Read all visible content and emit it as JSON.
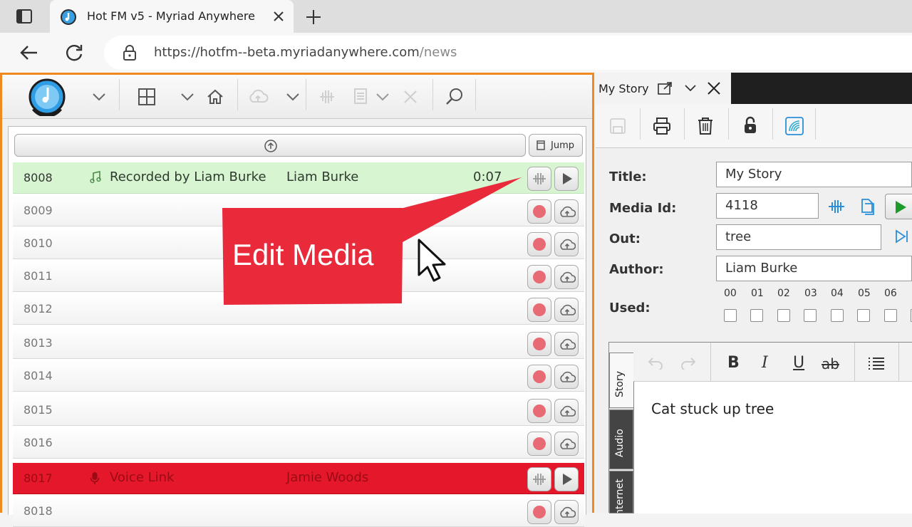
{
  "browser": {
    "tab_title": "Hot FM v5 - Myriad Anywhere",
    "url_host": "https://hotfm--beta.myriadanywhere.com",
    "url_path": "/news"
  },
  "list": {
    "jump_label": "Jump",
    "rows": [
      {
        "num": "8008",
        "title": "Recorded by Liam Burke",
        "author": "Liam Burke",
        "duration": "0:07",
        "state": "green"
      },
      {
        "num": "8009",
        "title": "",
        "author": "",
        "duration": "",
        "state": "empty"
      },
      {
        "num": "8010",
        "title": "",
        "author": "",
        "duration": "",
        "state": "empty"
      },
      {
        "num": "8011",
        "title": "",
        "author": "",
        "duration": "",
        "state": "empty"
      },
      {
        "num": "8012",
        "title": "",
        "author": "",
        "duration": "",
        "state": "empty"
      },
      {
        "num": "8013",
        "title": "",
        "author": "",
        "duration": "",
        "state": "empty"
      },
      {
        "num": "8014",
        "title": "",
        "author": "",
        "duration": "",
        "state": "empty"
      },
      {
        "num": "8015",
        "title": "",
        "author": "",
        "duration": "",
        "state": "empty"
      },
      {
        "num": "8016",
        "title": "",
        "author": "",
        "duration": "",
        "state": "empty"
      },
      {
        "num": "8017",
        "title": "Voice Link",
        "author": "Jamie Woods",
        "duration": "",
        "state": "red"
      },
      {
        "num": "8018",
        "title": "",
        "author": "",
        "duration": "",
        "state": "empty"
      }
    ]
  },
  "callout": {
    "text": "Edit Media"
  },
  "panel": {
    "tab_title": "My Story",
    "labels": {
      "title": "Title:",
      "media_id": "Media Id:",
      "out": "Out:",
      "author": "Author:",
      "used": "Used:"
    },
    "values": {
      "title": "My Story",
      "media_id": "4118",
      "out": "tree",
      "author": "Liam Burke"
    },
    "hours": [
      "00",
      "01",
      "02",
      "03",
      "04",
      "05",
      "06"
    ],
    "editor": {
      "tabs": [
        "Story",
        "Audio",
        "Internet"
      ],
      "content": "Cat stuck up tree"
    }
  },
  "colors": {
    "accent_orange": "#f08a20",
    "row_green": "#d8f5d2",
    "row_red": "#e4182a",
    "callout_red": "#e82a3a",
    "record_dot": "#e76a74",
    "play_green": "#1e9a2a",
    "icon_blue": "#2a8fd8"
  }
}
